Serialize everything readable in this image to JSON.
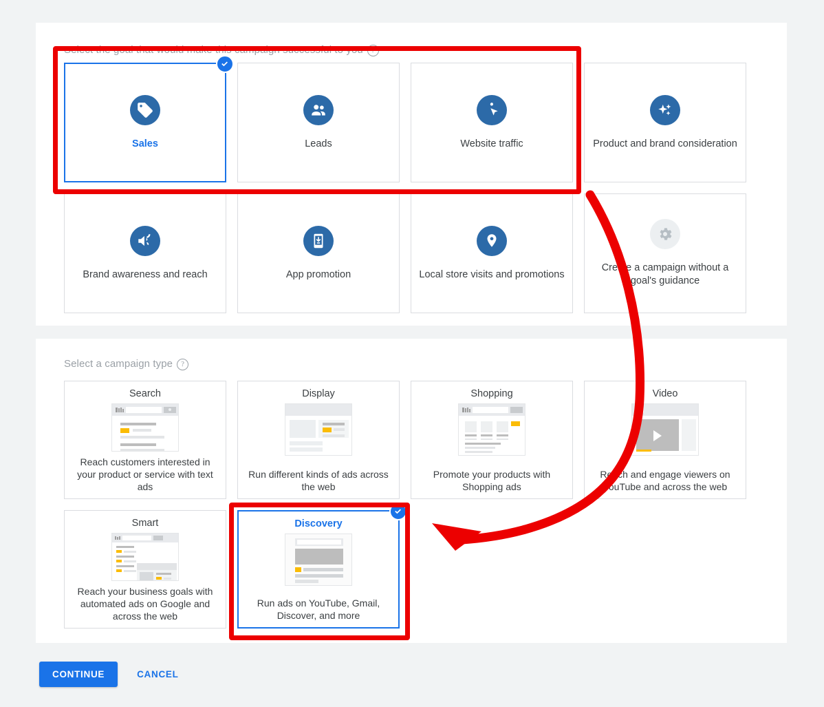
{
  "colors": {
    "accent": "#1a73e8",
    "annotation_red": "#ec0000",
    "icon_blue": "#2c6aa8",
    "page_background": "#f1f3f4",
    "muted_text": "#9aa0a6"
  },
  "goal_section": {
    "heading": "Select the goal that would make this campaign successful to you",
    "help_icon": "help-circle-icon",
    "cards": [
      {
        "label": "Sales",
        "icon": "price-tag-icon",
        "selected": true,
        "muted": false
      },
      {
        "label": "Leads",
        "icon": "people-icon",
        "selected": false,
        "muted": false
      },
      {
        "label": "Website traffic",
        "icon": "click-cursor-icon",
        "selected": false,
        "muted": false
      },
      {
        "label": "Product and brand consideration",
        "icon": "sparkle-icon",
        "selected": false,
        "muted": false
      },
      {
        "label": "Brand awareness and reach",
        "icon": "speaker-icon",
        "selected": false,
        "muted": false
      },
      {
        "label": "App promotion",
        "icon": "mobile-download-icon",
        "selected": false,
        "muted": false
      },
      {
        "label": "Local store visits and promotions",
        "icon": "location-pin-icon",
        "selected": false,
        "muted": false
      },
      {
        "label": "Create a campaign without a goal's guidance",
        "icon": "gear-icon",
        "selected": false,
        "muted": true
      }
    ]
  },
  "type_section": {
    "heading": "Select a campaign type",
    "help_icon": "help-circle-icon",
    "cards": [
      {
        "title": "Search",
        "description": "Reach customers interested in your product or service with text ads",
        "thumbnail": "search-results-thumbnail",
        "selected": false
      },
      {
        "title": "Display",
        "description": "Run different kinds of ads across the web",
        "thumbnail": "display-banner-thumbnail",
        "selected": false
      },
      {
        "title": "Shopping",
        "description": "Promote your products with Shopping ads",
        "thumbnail": "shopping-grid-thumbnail",
        "selected": false
      },
      {
        "title": "Video",
        "description": "Reach and engage viewers on YouTube and across the web",
        "thumbnail": "video-player-thumbnail",
        "selected": false
      },
      {
        "title": "Smart",
        "description": "Reach your business goals with automated ads on Google and across the web",
        "thumbnail": "smart-combo-thumbnail",
        "selected": false
      },
      {
        "title": "Discovery",
        "description": "Run ads on YouTube, Gmail, Discover, and more",
        "thumbnail": "discovery-feed-thumbnail",
        "selected": true
      }
    ]
  },
  "footer": {
    "continue_label": "CONTINUE",
    "cancel_label": "CANCEL"
  },
  "annotations": {
    "goal_highlight_label": "red-box-around-goal-row",
    "type_highlight_label": "red-box-around-discovery-card",
    "arrow_label": "red-curved-arrow-to-discovery"
  }
}
